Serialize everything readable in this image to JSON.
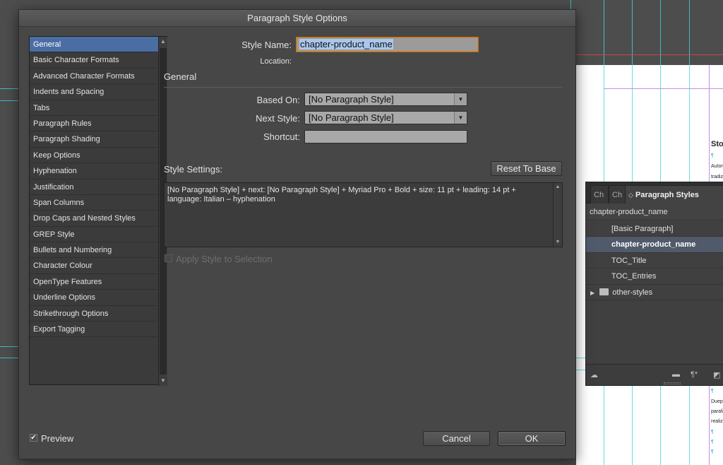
{
  "dialog": {
    "title": "Paragraph Style Options",
    "categories": [
      {
        "label": "General",
        "selected": true
      },
      {
        "label": "Basic Character Formats"
      },
      {
        "label": "Advanced Character Formats"
      },
      {
        "label": "Indents and Spacing"
      },
      {
        "label": "Tabs"
      },
      {
        "label": "Paragraph Rules"
      },
      {
        "label": "Paragraph Shading"
      },
      {
        "label": "Keep Options"
      },
      {
        "label": "Hyphenation"
      },
      {
        "label": "Justification"
      },
      {
        "label": "Span Columns"
      },
      {
        "label": "Drop Caps and Nested Styles"
      },
      {
        "label": "GREP Style"
      },
      {
        "label": "Bullets and Numbering"
      },
      {
        "label": "Character Colour"
      },
      {
        "label": "OpenType Features"
      },
      {
        "label": "Underline Options"
      },
      {
        "label": "Strikethrough Options"
      },
      {
        "label": "Export Tagging"
      }
    ],
    "style_name_label": "Style Name:",
    "style_name_value": "chapter-product_name",
    "location_label": "Location:",
    "section_title": "General",
    "based_on_label": "Based On:",
    "based_on_value": "[No Paragraph Style]",
    "next_style_label": "Next Style:",
    "next_style_value": "[No Paragraph Style]",
    "shortcut_label": "Shortcut:",
    "shortcut_value": "",
    "style_settings_label": "Style Settings:",
    "reset_button": "Reset To Base",
    "style_settings_text": "[No Paragraph Style] + next: [No Paragraph Style] + Myriad Pro + Bold + size: 11 pt + leading: 14 pt + language: Italian – hyphenation",
    "apply_style_label": "Apply Style to Selection",
    "apply_style_checked": false,
    "apply_style_enabled": false,
    "preview_label": "Preview",
    "preview_checked": true,
    "cancel_button": "Cancel",
    "ok_button": "OK"
  },
  "panel": {
    "tab1": "Ch",
    "tab2": "Ch",
    "active_tab": "Paragraph Styles",
    "current_style": "chapter-product_name",
    "styles": [
      {
        "label": "[Basic Paragraph]"
      },
      {
        "label": "chapter-product_name",
        "selected": true
      },
      {
        "label": "TOC_Title"
      },
      {
        "label": "TOC_Entries"
      }
    ],
    "group_label": "other-styles"
  },
  "document": {
    "heading": "Sto",
    "snippet_lines": [
      "Autom",
      "tradiz"
    ],
    "snippet_lines_2": [
      "Duepi",
      "parafa",
      "realizz"
    ],
    "pilcrow": "¶"
  },
  "colors": {
    "selection": "#4a6ea3",
    "focus_ring": "#d48a2e",
    "guide_cyan": "#3fd7e0",
    "guide_magenta": "#c78ae8"
  }
}
